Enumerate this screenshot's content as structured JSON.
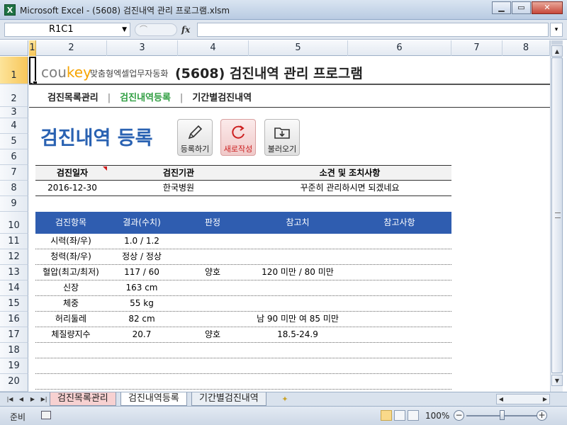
{
  "window": {
    "title": "Microsoft Excel - (5608) 검진내역 관리 프로그램.xlsm",
    "minimize": "▁",
    "restore": "▭",
    "close": "✕",
    "app_icon": "X"
  },
  "formula_bar": {
    "name_box": "R1C1",
    "fx": "fx",
    "formula": ""
  },
  "columns": [
    "1",
    "2",
    "3",
    "4",
    "5",
    "6",
    "7",
    "8"
  ],
  "rows": [
    "1",
    "2",
    "3",
    "4",
    "5",
    "6",
    "7",
    "8",
    "9",
    "10",
    "11",
    "12",
    "13",
    "14",
    "15",
    "16",
    "17",
    "18",
    "19",
    "20"
  ],
  "header": {
    "logo_main": "cou",
    "logo_key": "key",
    "logo_sub": "맞춤형엑셀업무자동화",
    "app_title": "(5608) 검진내역 관리 프로그램"
  },
  "nav": {
    "items": [
      "검진목록관리",
      "검진내역등록",
      "기간별검진내역"
    ],
    "separator": "|",
    "active": "검진내역등록"
  },
  "page": {
    "title": "검진내역 등록"
  },
  "actions": [
    {
      "label": "등록하기",
      "icon": "pencil-icon"
    },
    {
      "label": "새로작성",
      "icon": "refresh-icon"
    },
    {
      "label": "불러오기",
      "icon": "folder-download-icon"
    }
  ],
  "info_table": {
    "headers": [
      "검진일자",
      "검진기관",
      "소견 및 조치사항"
    ],
    "row": [
      "2016-12-30",
      "한국병원",
      "꾸준히 관리하시면 되겠네요"
    ]
  },
  "data_table": {
    "headers": [
      "검진항목",
      "결과(수치)",
      "판정",
      "참고치",
      "참고사항"
    ],
    "rows": [
      [
        "시력(좌/우)",
        "1.0 / 1.2",
        "",
        "",
        ""
      ],
      [
        "청력(좌/우)",
        "정상 / 정상",
        "",
        "",
        ""
      ],
      [
        "혈압(최고/최저)",
        "117 / 60",
        "양호",
        "120 미만 / 80 미만",
        ""
      ],
      [
        "신장",
        "163 cm",
        "",
        "",
        ""
      ],
      [
        "체중",
        "55 kg",
        "",
        "",
        ""
      ],
      [
        "허리둘레",
        "82 cm",
        "",
        "남 90 미만 여 85 미만",
        ""
      ],
      [
        "체질량지수",
        "20.7",
        "양호",
        "18.5-24.9",
        ""
      ],
      [
        "",
        "",
        "",
        "",
        ""
      ],
      [
        "",
        "",
        "",
        "",
        ""
      ],
      [
        "",
        "",
        "",
        "",
        ""
      ]
    ]
  },
  "sheet_tabs": [
    "검진목록관리",
    "검진내역등록",
    "기간별검진내역"
  ],
  "active_sheet": "검진내역등록",
  "status": {
    "mode": "준비",
    "zoom": "100%",
    "zoom_percent": 100
  },
  "colors": {
    "accent_blue": "#2f5db0",
    "title_blue": "#2a62b2",
    "nav_active": "#2f9e41",
    "logo_key": "#f6a400",
    "new_button_red": "#cc1f1f"
  }
}
